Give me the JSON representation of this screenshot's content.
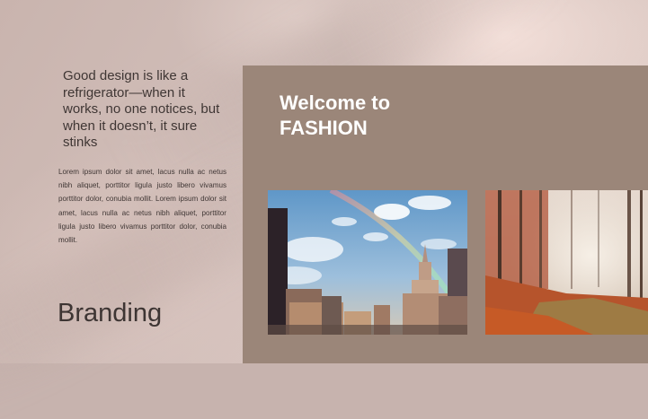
{
  "quote": {
    "text": "Good design is like a refrigerator—when it works, no one notices, but when it doesn’t, it sure stinks"
  },
  "body_text": "Lorem ipsum dolor sit amet, lacus nulla ac netus nibh aliquet, porttitor ligula justo libero vivamus porttitor dolor, conubia mollit. Lorem ipsum dolor sit amet, lacus nulla ac netus nibh aliquet, porttitor ligula justo libero vivamus porttitor dolor, conubia mollit.",
  "branding_label": "Branding",
  "panel": {
    "welcome_line1": "Welcome to",
    "welcome_line2": "FASHION"
  },
  "colors": {
    "background": "#c9b4ae",
    "panel": "#9b8679",
    "heading_text": "#ffffff",
    "body_text": "#3f3634"
  }
}
